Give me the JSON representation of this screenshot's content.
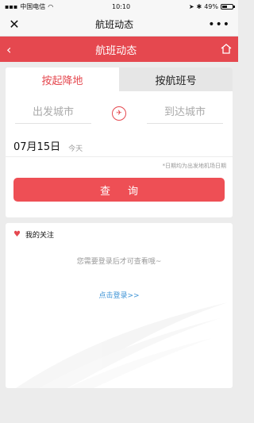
{
  "status_bar": {
    "carrier": "中国电信",
    "time": "10:10",
    "battery": "49%",
    "battery_level": 0.49
  },
  "wechat_bar": {
    "title": "航班动态",
    "close_icon": "close-icon",
    "more_icon": "more-dots-icon"
  },
  "header": {
    "title": "航班动态",
    "back_icon": "chevron-left-icon",
    "home_icon": "home-icon"
  },
  "tabs": [
    {
      "label": "按起降地",
      "active": true
    },
    {
      "label": "按航班号",
      "active": false
    }
  ],
  "search": {
    "departure_placeholder": "出发城市",
    "arrival_placeholder": "到达城市",
    "swap_icon": "plane-icon",
    "date": "07月15日",
    "date_note": "今天",
    "date_hint": "*日期均为出发地机场日期",
    "query_label": "查询"
  },
  "watchlist": {
    "title": "我的关注",
    "heart_icon": "heart-icon",
    "login_tip": "您需要登录后才可查看哦~",
    "login_link": "点击登录>>"
  },
  "colors": {
    "accent": "#e5484f",
    "link": "#3f94d6"
  }
}
